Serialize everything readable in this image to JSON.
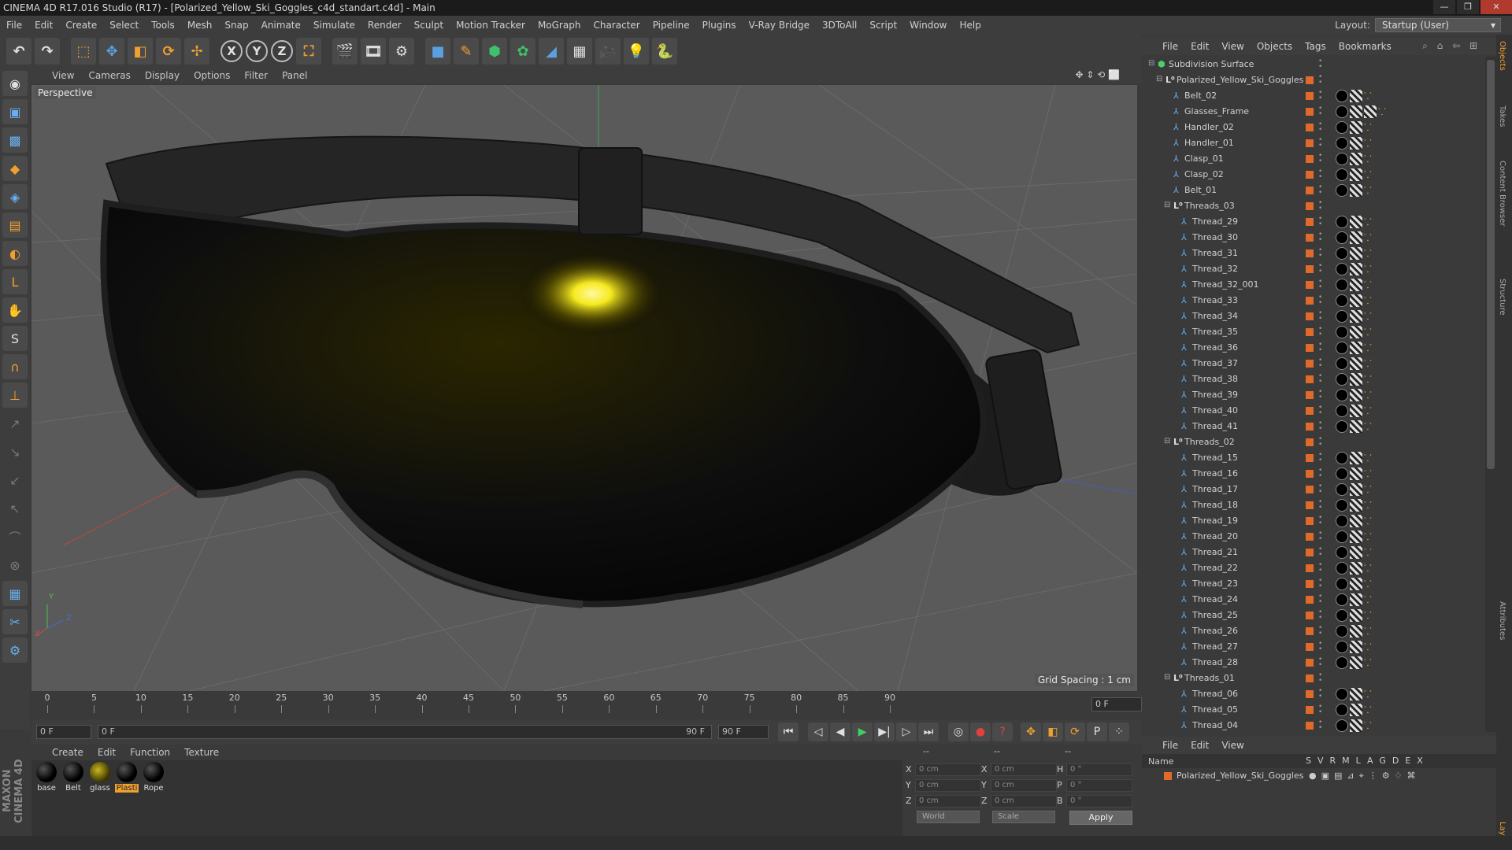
{
  "window": {
    "title": "CINEMA 4D R17.016 Studio (R17) - [Polarized_Yellow_Ski_Goggles_c4d_standart.c4d] - Main",
    "minimize": "—",
    "maximize": "❐",
    "close": "✕"
  },
  "menu": [
    "File",
    "Edit",
    "Create",
    "Select",
    "Tools",
    "Mesh",
    "Snap",
    "Animate",
    "Simulate",
    "Render",
    "Sculpt",
    "Motion Tracker",
    "MoGraph",
    "Character",
    "Pipeline",
    "Plugins",
    "V-Ray Bridge",
    "3DToAll",
    "Script",
    "Window",
    "Help"
  ],
  "layout": {
    "label": "Layout:",
    "value": "Startup (User)"
  },
  "toolbar": {
    "undo": "↶",
    "redo": "↷",
    "select": "⬚",
    "move": "✥",
    "scale": "◧",
    "rotate": "⟳",
    "transform": "✢",
    "x_axis": "X",
    "y_axis": "Y",
    "z_axis": "Z",
    "coord": "⛶",
    "render_view": "🎬",
    "render_picture": "🎞",
    "render_settings": "⚙",
    "cube": "■",
    "pen": "✎",
    "subdiv": "⬢",
    "array": "✿",
    "deformer": "◢",
    "floor": "▦",
    "camera": "🎥",
    "light": "💡",
    "python": "🐍"
  },
  "left_tools": [
    "◉",
    "▣",
    "▩",
    "◆",
    "◈",
    "▤",
    "◐",
    "L",
    "✋",
    "S",
    "∩",
    "⊥",
    "↗",
    "↘",
    "↙",
    "↖",
    "⌒",
    "⊗",
    "▦",
    "✂",
    "⚙"
  ],
  "viewport": {
    "menu": [
      "View",
      "Cameras",
      "Display",
      "Options",
      "Filter",
      "Panel"
    ],
    "nav_icons": "✥ ⇕ ⟲ ⬜",
    "label": "Perspective",
    "grid_spacing": "Grid Spacing : 1 cm",
    "axis_x": "X",
    "axis_y": "Y",
    "axis_z": "Z"
  },
  "timeline": {
    "ticks": [
      "0",
      "5",
      "10",
      "15",
      "20",
      "25",
      "30",
      "35",
      "40",
      "45",
      "50",
      "55",
      "60",
      "65",
      "70",
      "75",
      "80",
      "85",
      "90"
    ],
    "current_frame": "0 F",
    "start_field": "0 F",
    "range_start": "0 F",
    "range_end": "90 F",
    "end_field": "90 F"
  },
  "playback": {
    "first": "⏮",
    "prev_key": "◁",
    "prev": "◀",
    "play": "▶",
    "next": "▶|",
    "next_key": "▷",
    "last": "⏭",
    "record": "◎",
    "autokey": "●",
    "keysel": "?",
    "pos": "✥",
    "scl": "◧",
    "rot": "⟳",
    "param": "P",
    "pla": "⁘",
    "timeline_btn": "▤"
  },
  "materials": {
    "menu": [
      "Create",
      "Edit",
      "Function",
      "Texture"
    ],
    "items": [
      {
        "name": "base",
        "type": "dark",
        "selected": false
      },
      {
        "name": "Belt",
        "type": "dark",
        "selected": false
      },
      {
        "name": "glass",
        "type": "glass",
        "selected": false
      },
      {
        "name": "Plasti",
        "type": "dark",
        "selected": true
      },
      {
        "name": "Rope",
        "type": "dark",
        "selected": false
      }
    ]
  },
  "coordinates": {
    "header": [
      "--",
      "--",
      "--"
    ],
    "rows": [
      {
        "a": "X",
        "av": "0 cm",
        "b": "X",
        "bv": "0 cm",
        "c": "H",
        "cv": "0 °"
      },
      {
        "a": "Y",
        "av": "0 cm",
        "b": "Y",
        "bv": "0 cm",
        "c": "P",
        "cv": "0 °"
      },
      {
        "a": "Z",
        "av": "0 cm",
        "b": "Z",
        "bv": "0 cm",
        "c": "B",
        "cv": "0 °"
      }
    ],
    "mode": "World",
    "scale": "Scale",
    "apply": "Apply"
  },
  "objects": {
    "menu": [
      "File",
      "Edit",
      "View",
      "Objects",
      "Tags",
      "Bookmarks"
    ],
    "right_icons": "⌕ ⌂ ⇦ ⊞",
    "tree": [
      {
        "name": "Subdivision Surface",
        "level": 0,
        "icon": "green",
        "tw": "⊟",
        "tags": "",
        "vis": false
      },
      {
        "name": "Polarized_Yellow_Ski_Goggles",
        "level": 1,
        "icon": "null",
        "tw": "⊟",
        "tags": "",
        "vis": true
      },
      {
        "name": "Belt_02",
        "level": 2,
        "icon": "poly",
        "tw": "",
        "tags": "mat",
        "vis": true
      },
      {
        "name": "Glasses_Frame",
        "level": 2,
        "icon": "poly",
        "tw": "",
        "tags": "mat2",
        "vis": true
      },
      {
        "name": "Handler_02",
        "level": 2,
        "icon": "poly",
        "tw": "",
        "tags": "mat",
        "vis": true
      },
      {
        "name": "Handler_01",
        "level": 2,
        "icon": "poly",
        "tw": "",
        "tags": "mat",
        "vis": true
      },
      {
        "name": "Clasp_01",
        "level": 2,
        "icon": "poly",
        "tw": "",
        "tags": "mat",
        "vis": true
      },
      {
        "name": "Clasp_02",
        "level": 2,
        "icon": "poly",
        "tw": "",
        "tags": "mat",
        "vis": true
      },
      {
        "name": "Belt_01",
        "level": 2,
        "icon": "poly",
        "tw": "",
        "tags": "mat",
        "vis": true
      },
      {
        "name": "Threads_03",
        "level": 2,
        "icon": "null",
        "tw": "⊟",
        "tags": "",
        "vis": true
      },
      {
        "name": "Thread_29",
        "level": 3,
        "icon": "poly",
        "tw": "",
        "tags": "mat",
        "vis": true
      },
      {
        "name": "Thread_30",
        "level": 3,
        "icon": "poly",
        "tw": "",
        "tags": "mat",
        "vis": true
      },
      {
        "name": "Thread_31",
        "level": 3,
        "icon": "poly",
        "tw": "",
        "tags": "mat",
        "vis": true
      },
      {
        "name": "Thread_32",
        "level": 3,
        "icon": "poly",
        "tw": "",
        "tags": "mat",
        "vis": true
      },
      {
        "name": "Thread_32_001",
        "level": 3,
        "icon": "poly",
        "tw": "",
        "tags": "mat",
        "vis": true
      },
      {
        "name": "Thread_33",
        "level": 3,
        "icon": "poly",
        "tw": "",
        "tags": "mat",
        "vis": true
      },
      {
        "name": "Thread_34",
        "level": 3,
        "icon": "poly",
        "tw": "",
        "tags": "mat",
        "vis": true
      },
      {
        "name": "Thread_35",
        "level": 3,
        "icon": "poly",
        "tw": "",
        "tags": "mat",
        "vis": true
      },
      {
        "name": "Thread_36",
        "level": 3,
        "icon": "poly",
        "tw": "",
        "tags": "mat",
        "vis": true
      },
      {
        "name": "Thread_37",
        "level": 3,
        "icon": "poly",
        "tw": "",
        "tags": "mat",
        "vis": true
      },
      {
        "name": "Thread_38",
        "level": 3,
        "icon": "poly",
        "tw": "",
        "tags": "mat",
        "vis": true
      },
      {
        "name": "Thread_39",
        "level": 3,
        "icon": "poly",
        "tw": "",
        "tags": "mat",
        "vis": true
      },
      {
        "name": "Thread_40",
        "level": 3,
        "icon": "poly",
        "tw": "",
        "tags": "mat",
        "vis": true
      },
      {
        "name": "Thread_41",
        "level": 3,
        "icon": "poly",
        "tw": "",
        "tags": "mat",
        "vis": true
      },
      {
        "name": "Threads_02",
        "level": 2,
        "icon": "null",
        "tw": "⊟",
        "tags": "",
        "vis": true
      },
      {
        "name": "Thread_15",
        "level": 3,
        "icon": "poly",
        "tw": "",
        "tags": "mat",
        "vis": true
      },
      {
        "name": "Thread_16",
        "level": 3,
        "icon": "poly",
        "tw": "",
        "tags": "mat",
        "vis": true
      },
      {
        "name": "Thread_17",
        "level": 3,
        "icon": "poly",
        "tw": "",
        "tags": "mat",
        "vis": true
      },
      {
        "name": "Thread_18",
        "level": 3,
        "icon": "poly",
        "tw": "",
        "tags": "mat",
        "vis": true
      },
      {
        "name": "Thread_19",
        "level": 3,
        "icon": "poly",
        "tw": "",
        "tags": "mat",
        "vis": true
      },
      {
        "name": "Thread_20",
        "level": 3,
        "icon": "poly",
        "tw": "",
        "tags": "mat",
        "vis": true
      },
      {
        "name": "Thread_21",
        "level": 3,
        "icon": "poly",
        "tw": "",
        "tags": "mat",
        "vis": true
      },
      {
        "name": "Thread_22",
        "level": 3,
        "icon": "poly",
        "tw": "",
        "tags": "mat",
        "vis": true
      },
      {
        "name": "Thread_23",
        "level": 3,
        "icon": "poly",
        "tw": "",
        "tags": "mat",
        "vis": true
      },
      {
        "name": "Thread_24",
        "level": 3,
        "icon": "poly",
        "tw": "",
        "tags": "mat",
        "vis": true
      },
      {
        "name": "Thread_25",
        "level": 3,
        "icon": "poly",
        "tw": "",
        "tags": "mat",
        "vis": true
      },
      {
        "name": "Thread_26",
        "level": 3,
        "icon": "poly",
        "tw": "",
        "tags": "mat",
        "vis": true
      },
      {
        "name": "Thread_27",
        "level": 3,
        "icon": "poly",
        "tw": "",
        "tags": "mat",
        "vis": true
      },
      {
        "name": "Thread_28",
        "level": 3,
        "icon": "poly",
        "tw": "",
        "tags": "mat",
        "vis": true
      },
      {
        "name": "Threads_01",
        "level": 2,
        "icon": "null",
        "tw": "⊟",
        "tags": "",
        "vis": true
      },
      {
        "name": "Thread_06",
        "level": 3,
        "icon": "poly",
        "tw": "",
        "tags": "mat",
        "vis": true
      },
      {
        "name": "Thread_05",
        "level": 3,
        "icon": "poly",
        "tw": "",
        "tags": "mat",
        "vis": true
      },
      {
        "name": "Thread_04",
        "level": 3,
        "icon": "poly",
        "tw": "",
        "tags": "mat",
        "vis": true
      }
    ]
  },
  "layers": {
    "menu": [
      "File",
      "Edit",
      "View"
    ],
    "name_header": "Name",
    "cols": "SVRMLAGDEX",
    "row_name": "Polarized_Yellow_Ski_Goggles",
    "row_icons": "●▣▤⊿⌖⋮⚙♢⌘"
  },
  "right_tabs": [
    "Objects",
    "Takes",
    "Content Browser",
    "Structure",
    "Attributes",
    "Layers"
  ],
  "colors": {
    "accent": "#f0a030",
    "vis": "#e06a2a",
    "viewport": "#5a5a5a",
    "glow": "#f6ea20"
  }
}
